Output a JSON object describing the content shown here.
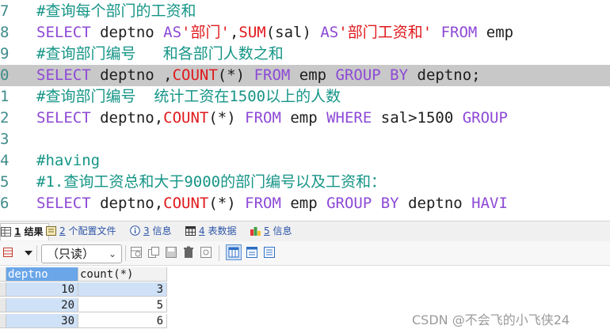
{
  "editor": {
    "lines": [
      {
        "num": "7",
        "tokens": [
          {
            "t": "#查询每个部门的工资和",
            "c": "cm"
          }
        ]
      },
      {
        "num": "8",
        "tokens": [
          {
            "t": "SELECT",
            "c": "kw"
          },
          {
            "t": " deptno ",
            "c": "pl"
          },
          {
            "t": "AS",
            "c": "kw"
          },
          {
            "t": "'部门'",
            "c": "str"
          },
          {
            "t": ",",
            "c": "pl"
          },
          {
            "t": "SUM",
            "c": "fn"
          },
          {
            "t": "(sal) ",
            "c": "pl"
          },
          {
            "t": "AS",
            "c": "kw"
          },
          {
            "t": "'部门工资和'",
            "c": "str"
          },
          {
            "t": " ",
            "c": "pl"
          },
          {
            "t": "FROM",
            "c": "kw"
          },
          {
            "t": " emp",
            "c": "pl"
          }
        ]
      },
      {
        "num": "9",
        "tokens": [
          {
            "t": "#查询部门编号   和各部门人数之和",
            "c": "cm"
          }
        ]
      },
      {
        "num": "0",
        "hl": true,
        "tokens": [
          {
            "t": "SELECT",
            "c": "kw"
          },
          {
            "t": " deptno ,",
            "c": "pl"
          },
          {
            "t": "COUNT",
            "c": "fn"
          },
          {
            "t": "(*)",
            "c": "pl"
          },
          {
            "t": " ",
            "c": "pl"
          },
          {
            "t": "FROM",
            "c": "kw"
          },
          {
            "t": " emp ",
            "c": "pl"
          },
          {
            "t": "GROUP BY",
            "c": "kw"
          },
          {
            "t": " deptno;",
            "c": "pl"
          }
        ]
      },
      {
        "num": "1",
        "tokens": [
          {
            "t": "#查询部门编号  统计工资在1500以上的人数",
            "c": "cm"
          }
        ]
      },
      {
        "num": "2",
        "tokens": [
          {
            "t": "SELECT",
            "c": "kw"
          },
          {
            "t": " deptno,",
            "c": "pl"
          },
          {
            "t": "COUNT",
            "c": "fn"
          },
          {
            "t": "(*)",
            "c": "pl"
          },
          {
            "t": " ",
            "c": "pl"
          },
          {
            "t": "FROM",
            "c": "kw"
          },
          {
            "t": " emp ",
            "c": "pl"
          },
          {
            "t": "WHERE",
            "c": "kw"
          },
          {
            "t": " sal>1500 ",
            "c": "pl"
          },
          {
            "t": "GROUP",
            "c": "kw"
          }
        ]
      },
      {
        "num": "3",
        "tokens": []
      },
      {
        "num": "4",
        "tokens": [
          {
            "t": "#having",
            "c": "cm"
          }
        ]
      },
      {
        "num": "5",
        "tokens": [
          {
            "t": "#1.查询工资总和大于9000的部门编号以及工资和：",
            "c": "cm"
          }
        ]
      },
      {
        "num": "6",
        "tokens": [
          {
            "t": "SELECT",
            "c": "kw"
          },
          {
            "t": " deptno,",
            "c": "pl"
          },
          {
            "t": "COUNT",
            "c": "fn"
          },
          {
            "t": "(*)",
            "c": "pl"
          },
          {
            "t": " ",
            "c": "pl"
          },
          {
            "t": "FROM",
            "c": "kw"
          },
          {
            "t": " emp ",
            "c": "pl"
          },
          {
            "t": "GROUP BY",
            "c": "kw"
          },
          {
            "t": " deptno ",
            "c": "pl"
          },
          {
            "t": "HAVI",
            "c": "kw"
          }
        ]
      }
    ]
  },
  "tabs": [
    {
      "num": "1",
      "label": "结果",
      "icon": "result-grid-icon",
      "active": true
    },
    {
      "num": "2",
      "label": "个配置文件",
      "icon": "profile-icon",
      "active": false
    },
    {
      "num": "3",
      "label": "信息",
      "icon": "info-icon",
      "active": false
    },
    {
      "num": "4",
      "label": "表数据",
      "icon": "table-data-icon",
      "active": false
    },
    {
      "num": "5",
      "label": "信息",
      "icon": "info-color-icon",
      "active": false
    }
  ],
  "toolbar": {
    "mode_select_value": "（只读）"
  },
  "grid": {
    "columns": [
      "deptno",
      "count(*)"
    ],
    "rows": [
      {
        "deptno": "10",
        "count": "3"
      },
      {
        "deptno": "20",
        "count": "5"
      },
      {
        "deptno": "30",
        "count": "6"
      }
    ]
  },
  "watermark": "CSDN @不会飞的小飞侠24",
  "colors": {
    "keyword": "#8d49d6",
    "string": "#e0191c",
    "comment": "#169587",
    "line_highlight": "#c8c8c8",
    "selected_header": "#6aa6e8",
    "selected_cell": "#cfe1f6"
  }
}
